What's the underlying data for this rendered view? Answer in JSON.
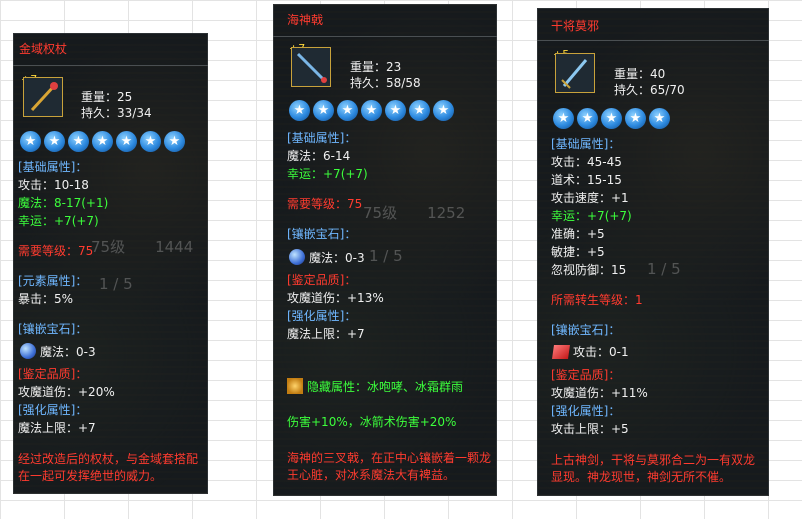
{
  "colors": {
    "title": "#ff3b2f",
    "section": "#6fb7ff",
    "bonus": "#3cff3c",
    "star": "#2d8ae0"
  },
  "icons": {
    "star": "blue-star-icon",
    "gem_blue": "blue-gem-icon",
    "gem_red": "red-gem-icon",
    "hidden": "hidden-attr-icon"
  },
  "card1": {
    "name": "金域权杖",
    "plus": "+7",
    "weight": "重量：25",
    "durability": "持久：33/34",
    "stars": 7,
    "base_header": "[基础属性]：",
    "attack": "攻击：10-18",
    "magic": "魔法：8-17(+1)",
    "luck": "幸运：+7(+7)",
    "req_level": "需要等级：75",
    "element_header": "[元素属性]：",
    "crit": "暴击：5%",
    "inlay_header": "[镶嵌宝石]：",
    "inlay_value": "魔法：0-3",
    "appraise_header": "[鉴定品质]：",
    "appraise_value": "攻魔道伤：+20%",
    "enhance_header": "[强化属性]：",
    "enhance_value": "魔法上限：+7",
    "desc": "经过改造后的权杖，与金域套搭配在一起可发挥绝世的威力。"
  },
  "card2": {
    "name": "海神戟",
    "plus": "+7",
    "weight": "重量：23",
    "durability": "持久：58/58",
    "stars": 7,
    "base_header": "[基础属性]：",
    "magic": "魔法：6-14",
    "luck": "幸运：+7(+7)",
    "req_level": "需要等级：75",
    "inlay_header": "[镶嵌宝石]：",
    "inlay_value": "魔法：0-3",
    "appraise_header": "[鉴定品质]：",
    "appraise_value": "攻魔道伤：+13%",
    "enhance_header": "[强化属性]：",
    "enhance_value": "魔法上限：+7",
    "hidden_attr": "隐藏属性：冰咆哮、冰霜群雨",
    "hidden_bonus": "伤害+10%，冰箭术伤害+20%",
    "desc": "海神的三叉戟，在正中心镶嵌着一颗龙王心脏，对冰系魔法大有裨益。"
  },
  "card3": {
    "name": "干将莫邪",
    "plus": "+5",
    "weight": "重量：40",
    "durability": "持久：65/70",
    "stars": 5,
    "base_header": "[基础属性]：",
    "attack": "攻击：45-45",
    "tao": "道术：15-15",
    "speed": "攻击速度：+1",
    "luck": "幸运：+7(+7)",
    "accuracy": "准确：+5",
    "agility": "敏捷：+5",
    "ignore_def": "忽视防御：15",
    "req_rebirth": "所需转生等级：1",
    "inlay_header": "[镶嵌宝石]：",
    "inlay_value": "攻击：0-1",
    "appraise_header": "[鉴定品质]：",
    "appraise_value": "攻魔道伤：+11%",
    "enhance_header": "[强化属性]：",
    "enhance_value": "攻击上限：+5",
    "desc": "上古神剑，干将与莫邪合二为一有双龙显现。神龙现世，神剑无所不催。"
  }
}
